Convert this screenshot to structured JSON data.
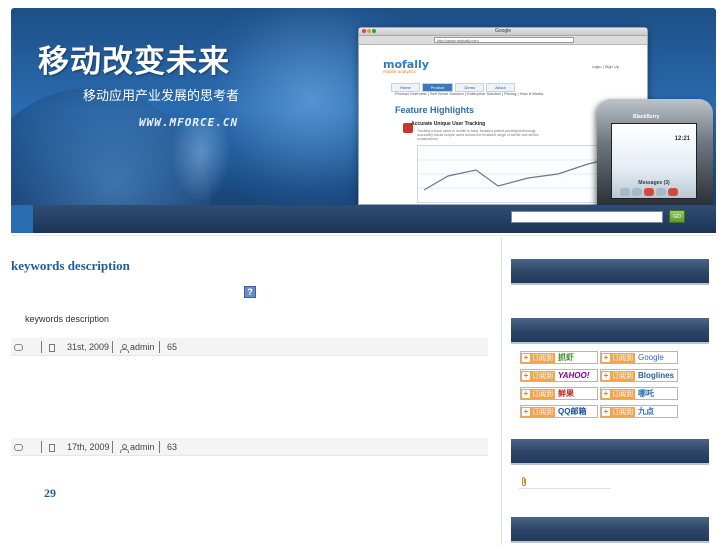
{
  "banner": {
    "title_cn": "移动改变未来",
    "subtitle_cn": "移动应用产业发展的思考者",
    "site_url": "WWW.MFORCE.CN",
    "search_button_label": "GO",
    "browser": {
      "window_title": "Google",
      "address": "http://www.mobally.com",
      "logo": "mofally",
      "logo_tagline": "mobile analytics",
      "login_text": "Login | Sign Up",
      "tabs": [
        "Home",
        "Product",
        "Demo",
        "About"
      ],
      "subnav": "Product Overview  |  Self Serve Solution  |  Enterprise Solution  |  Pricing  |  How It Works",
      "feature_heading": "Feature Highlights",
      "feature_title": "Accurate Unique User Tracking",
      "feature_desc": "Tracking unique users in mobile is hard. Mofally's patent-pending technology accurately tracks unique users across the broadest range of carrier and device combinations."
    },
    "phone": {
      "brand": "BlackBerry",
      "time": "12:21",
      "messages": "Messages (3)"
    }
  },
  "main": {
    "post_title": "keywords  description",
    "broken_image_glyph": "?",
    "excerpt": "keywords description",
    "posts_meta": [
      {
        "date": "31st, 2009",
        "author": "admin",
        "count": "65"
      },
      {
        "date": "17th, 2009",
        "author": "admin",
        "count": "63"
      }
    ],
    "page_number": "29"
  },
  "sidebar": {
    "subscribe_label": "订阅到",
    "feeds": [
      {
        "service": "抓虾",
        "style": "zhuaxia"
      },
      {
        "service": "Google",
        "style": "google"
      },
      {
        "service": "YAHOO!",
        "style": "yahoo"
      },
      {
        "service": "Bloglines",
        "style": "bloglines"
      },
      {
        "service": "鲜果",
        "style": "xianguo"
      },
      {
        "service": "哪吒",
        "style": "other"
      },
      {
        "service": "QQ邮箱",
        "style": "qq"
      },
      {
        "service": "九点",
        "style": "other"
      }
    ],
    "link_icon": "paperclip-icon"
  },
  "colors": {
    "banner_blue": "#2a6bb0",
    "link_blue": "#1e5d9c",
    "widget_head": "#2c4567",
    "feed_orange": "#f3a34a"
  }
}
